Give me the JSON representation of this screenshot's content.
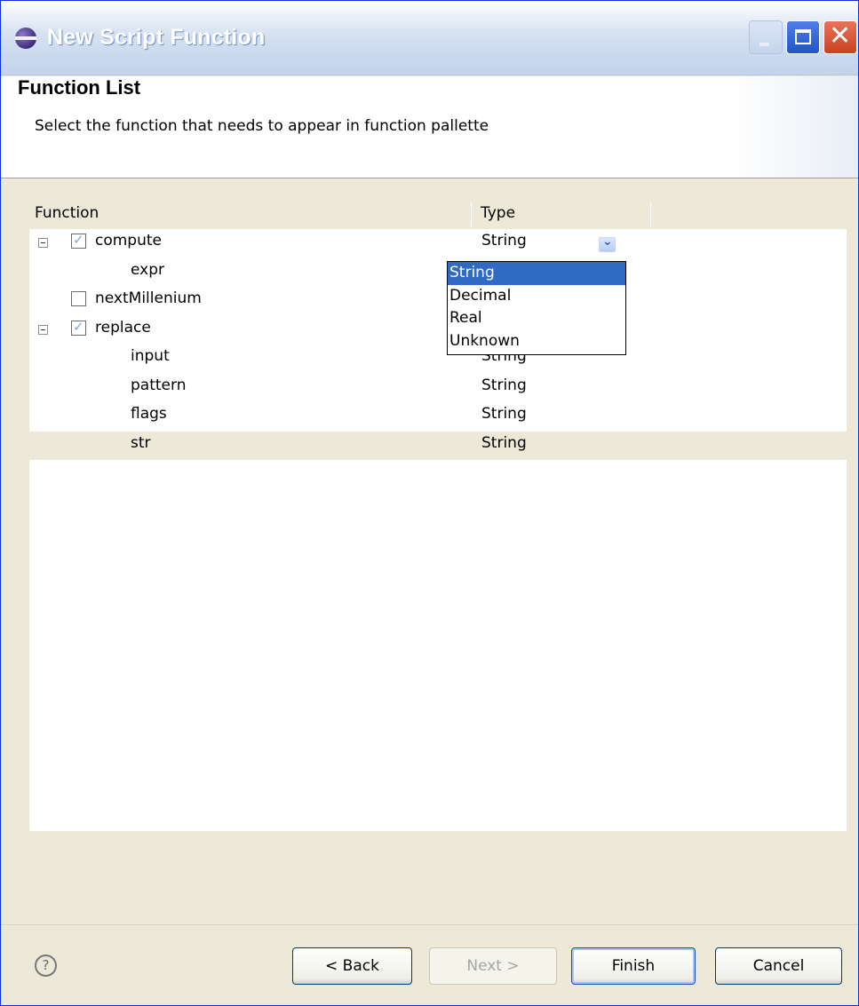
{
  "window": {
    "title": "New Script Function"
  },
  "header": {
    "title": "Function List",
    "description": "Select the function that needs to appear in function pallette"
  },
  "table": {
    "columns": [
      "Function",
      "Type"
    ],
    "rows": [
      {
        "name": "compute",
        "type": "String",
        "level": 0,
        "expandable": true,
        "checked": true
      },
      {
        "name": "expr",
        "type": "String",
        "level": 1
      },
      {
        "name": "nextMillenium",
        "type": "String",
        "level": 0,
        "checked": false
      },
      {
        "name": "replace",
        "type": "String",
        "level": 0,
        "expandable": true,
        "checked": true
      },
      {
        "name": "input",
        "type": "String",
        "level": 1
      },
      {
        "name": "pattern",
        "type": "String",
        "level": 1
      },
      {
        "name": "flags",
        "type": "String",
        "level": 1
      },
      {
        "name": "str",
        "type": "String",
        "level": 1,
        "editing": true
      }
    ]
  },
  "type_dropdown": {
    "options": [
      "String",
      "Decimal",
      "Real",
      "Unknown"
    ],
    "selected": "String"
  },
  "buttons": {
    "back": "< Back",
    "next": "Next >",
    "finish": "Finish",
    "cancel": "Cancel"
  },
  "icons": {
    "help": "help-icon",
    "app": "eclipse-icon"
  },
  "colors": {
    "selection": "#316ac5"
  }
}
